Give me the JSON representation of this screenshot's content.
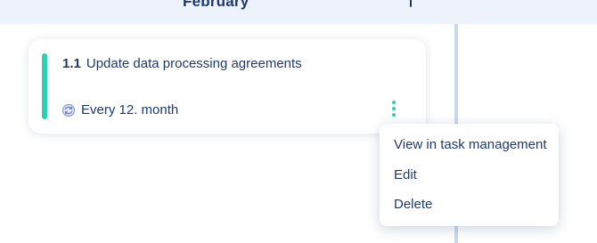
{
  "header": {
    "month": "February",
    "add_icon": "plus-icon"
  },
  "task": {
    "number": "1.1",
    "title": "Update data processing agreements",
    "recurrence": "Every 12. month",
    "recurrence_icon": "repeat-icon",
    "status_color": "#2ecfb8",
    "more_icon": "vertical-ellipsis-icon"
  },
  "context_menu": {
    "items": [
      {
        "label": "View in task management"
      },
      {
        "label": "Edit"
      },
      {
        "label": "Delete"
      }
    ]
  },
  "colors": {
    "primary_text": "#1f3a68",
    "accent": "#2ecfb8",
    "header_bg": "#eef3fb",
    "timeline": "#c9d8ee"
  }
}
